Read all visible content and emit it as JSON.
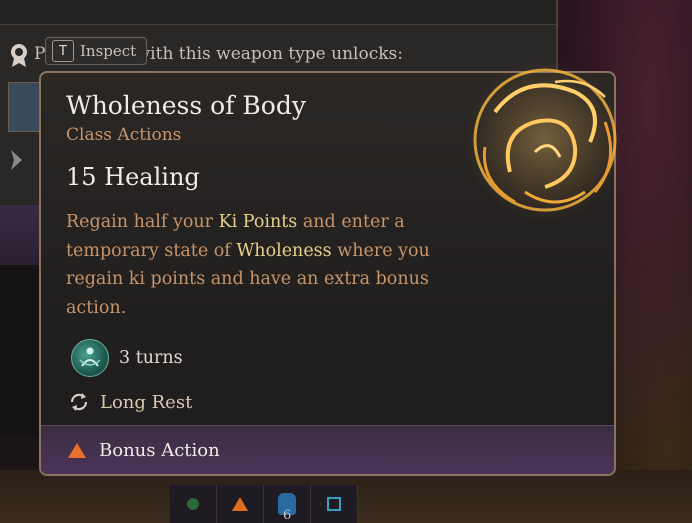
{
  "background_panel": {
    "partial_text": "Proficiency with this weapon type unlocks:"
  },
  "inspect_chip": {
    "key": "T",
    "label": "Inspect"
  },
  "tooltip": {
    "title": "Wholeness of Body",
    "subtitle": "Class Actions",
    "effect": "15 Healing",
    "description": {
      "p1": "Regain half your ",
      "h1": "Ki Points",
      "p2": " and enter a temporary state of ",
      "h2": "Wholeness",
      "p3": " where you regain ki points and have an extra bonus action."
    },
    "duration": "3 turns",
    "recharge": "Long Rest",
    "action_type": "Bonus Action"
  },
  "hotbar": {
    "hand_count": "6"
  },
  "colors": {
    "title": "#f0ebe4",
    "subtitle": "#c8956a",
    "highlight": "#e8d08a",
    "emblem_glow": "#f0a030",
    "footer": "#4a3458",
    "action_triangle": "#e8702a"
  }
}
